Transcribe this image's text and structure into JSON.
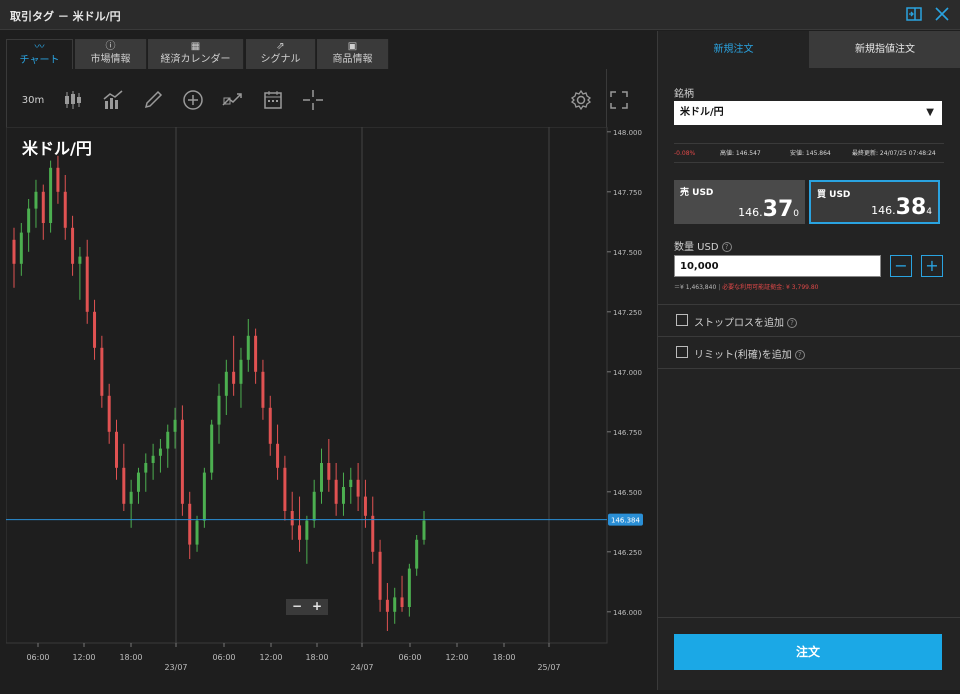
{
  "window": {
    "title": "取引タグ － 米ドル/円",
    "dock_icon": "dock-panel-icon",
    "close_icon": "close-icon"
  },
  "tabs": [
    {
      "label": "チャート",
      "icon": "line-chart-icon",
      "glyph": "〰",
      "active": true
    },
    {
      "label": "市場情報",
      "icon": "info-icon",
      "glyph": "ⓘ"
    },
    {
      "label": "経済カレンダー",
      "icon": "calendar-icon",
      "glyph": "▦"
    },
    {
      "label": "シグナル",
      "icon": "signal-icon",
      "glyph": "⇗"
    },
    {
      "label": "商品情報",
      "icon": "presentation-icon",
      "glyph": "▣"
    }
  ],
  "toolbar": {
    "timeframe": "30m",
    "tools": [
      "candlestick-icon",
      "indicator-icon",
      "pencil-icon",
      "add-circle-icon",
      "compare-icon",
      "calendar-event-icon",
      "crosshair-icon"
    ],
    "right_tools": [
      "settings-icon",
      "fullscreen-icon"
    ]
  },
  "chart_data": {
    "type": "candlestick",
    "title": "米ドル/円",
    "y_ticks": [
      "148.000",
      "147.750",
      "147.500",
      "147.250",
      "147.000",
      "146.750",
      "146.500",
      "146.250",
      "146.000"
    ],
    "ylim": [
      145.87,
      148.02
    ],
    "x_ticks": [
      "06:00",
      "12:00",
      "18:00",
      "23/07",
      "06:00",
      "12:00",
      "18:00",
      "24/07",
      "06:00",
      "12:00",
      "18:00",
      "25/07"
    ],
    "current_price": "146.384",
    "current_value": 146.384,
    "day_separators": [
      "23/07",
      "24/07",
      "25/07"
    ],
    "candles": [
      [
        147.55,
        147.6,
        147.35,
        147.45
      ],
      [
        147.45,
        147.62,
        147.4,
        147.58
      ],
      [
        147.58,
        147.72,
        147.5,
        147.68
      ],
      [
        147.68,
        147.8,
        147.6,
        147.75
      ],
      [
        147.75,
        147.78,
        147.55,
        147.62
      ],
      [
        147.62,
        147.88,
        147.58,
        147.85
      ],
      [
        147.85,
        147.9,
        147.7,
        147.75
      ],
      [
        147.75,
        147.82,
        147.55,
        147.6
      ],
      [
        147.6,
        147.65,
        147.4,
        147.45
      ],
      [
        147.45,
        147.52,
        147.3,
        147.48
      ],
      [
        147.48,
        147.55,
        147.2,
        147.25
      ],
      [
        147.25,
        147.3,
        147.05,
        147.1
      ],
      [
        147.1,
        147.15,
        146.85,
        146.9
      ],
      [
        146.9,
        146.95,
        146.7,
        146.75
      ],
      [
        146.75,
        146.8,
        146.55,
        146.6
      ],
      [
        146.6,
        146.7,
        146.42,
        146.45
      ],
      [
        146.45,
        146.55,
        146.35,
        146.5
      ],
      [
        146.5,
        146.6,
        146.45,
        146.58
      ],
      [
        146.58,
        146.66,
        146.5,
        146.62
      ],
      [
        146.62,
        146.7,
        146.55,
        146.65
      ],
      [
        146.65,
        146.72,
        146.58,
        146.68
      ],
      [
        146.68,
        146.78,
        146.6,
        146.75
      ],
      [
        146.75,
        146.85,
        146.68,
        146.8
      ],
      [
        146.8,
        146.86,
        146.4,
        146.45
      ],
      [
        146.45,
        146.5,
        146.22,
        146.28
      ],
      [
        146.28,
        146.4,
        146.25,
        146.38
      ],
      [
        146.38,
        146.6,
        146.35,
        146.58
      ],
      [
        146.58,
        146.8,
        146.55,
        146.78
      ],
      [
        146.78,
        146.95,
        146.7,
        146.9
      ],
      [
        146.9,
        147.05,
        146.82,
        147.0
      ],
      [
        147.0,
        147.15,
        146.9,
        146.95
      ],
      [
        146.95,
        147.1,
        146.85,
        147.05
      ],
      [
        147.05,
        147.22,
        147.0,
        147.15
      ],
      [
        147.15,
        147.18,
        146.95,
        147.0
      ],
      [
        147.0,
        147.05,
        146.8,
        146.85
      ],
      [
        146.85,
        146.9,
        146.65,
        146.7
      ],
      [
        146.7,
        146.78,
        146.55,
        146.6
      ],
      [
        146.6,
        146.65,
        146.38,
        146.42
      ],
      [
        146.42,
        146.5,
        146.3,
        146.36
      ],
      [
        146.36,
        146.48,
        146.25,
        146.3
      ],
      [
        146.3,
        146.4,
        146.2,
        146.38
      ],
      [
        146.38,
        146.55,
        146.35,
        146.5
      ],
      [
        146.5,
        146.68,
        146.45,
        146.62
      ],
      [
        146.62,
        146.72,
        146.5,
        146.55
      ],
      [
        146.55,
        146.62,
        146.4,
        146.45
      ],
      [
        146.45,
        146.58,
        146.4,
        146.52
      ],
      [
        146.52,
        146.6,
        146.45,
        146.55
      ],
      [
        146.55,
        146.62,
        146.42,
        146.48
      ],
      [
        146.48,
        146.55,
        146.35,
        146.4
      ],
      [
        146.4,
        146.48,
        146.2,
        146.25
      ],
      [
        146.25,
        146.3,
        146.0,
        146.05
      ],
      [
        146.05,
        146.12,
        145.92,
        146.0
      ],
      [
        146.0,
        146.1,
        145.95,
        146.06
      ],
      [
        146.06,
        146.15,
        146.0,
        146.02
      ],
      [
        146.02,
        146.2,
        145.98,
        146.18
      ],
      [
        146.18,
        146.32,
        146.15,
        146.3
      ],
      [
        146.3,
        146.42,
        146.28,
        146.38
      ]
    ]
  },
  "order_panel": {
    "tab_new": "新規注文",
    "tab_limit": "新規指値注文",
    "symbol_label": "銘柄",
    "symbol_value": "米ドル/円",
    "change": "-0.08%",
    "high": "高値: 146.547",
    "low": "安値: 145.864",
    "updated": "最終更新: 24/07/25 07:48:24",
    "sell": {
      "label": "売 USD",
      "prefix": "146.",
      "big": "37",
      "suffix": "0"
    },
    "buy": {
      "label": "買 USD",
      "prefix": "146.",
      "big": "38",
      "suffix": "4"
    },
    "qty_label": "数量 USD",
    "qty_value": "10,000",
    "qty_minus": "−",
    "qty_plus": "+",
    "jpy_value": "＝¥ 1,463,840",
    "margin_note": "必要な利用可能証拠金: ¥ 3,799.80",
    "stop_loss": "ストップロスを追加",
    "limit": "リミット(利確)を追加",
    "help_glyph": "?",
    "submit": "注文"
  },
  "colors": {
    "up": "#4caf50",
    "down": "#e05252",
    "accent": "#2aa3e0",
    "price_line": "#2a8fd6"
  }
}
